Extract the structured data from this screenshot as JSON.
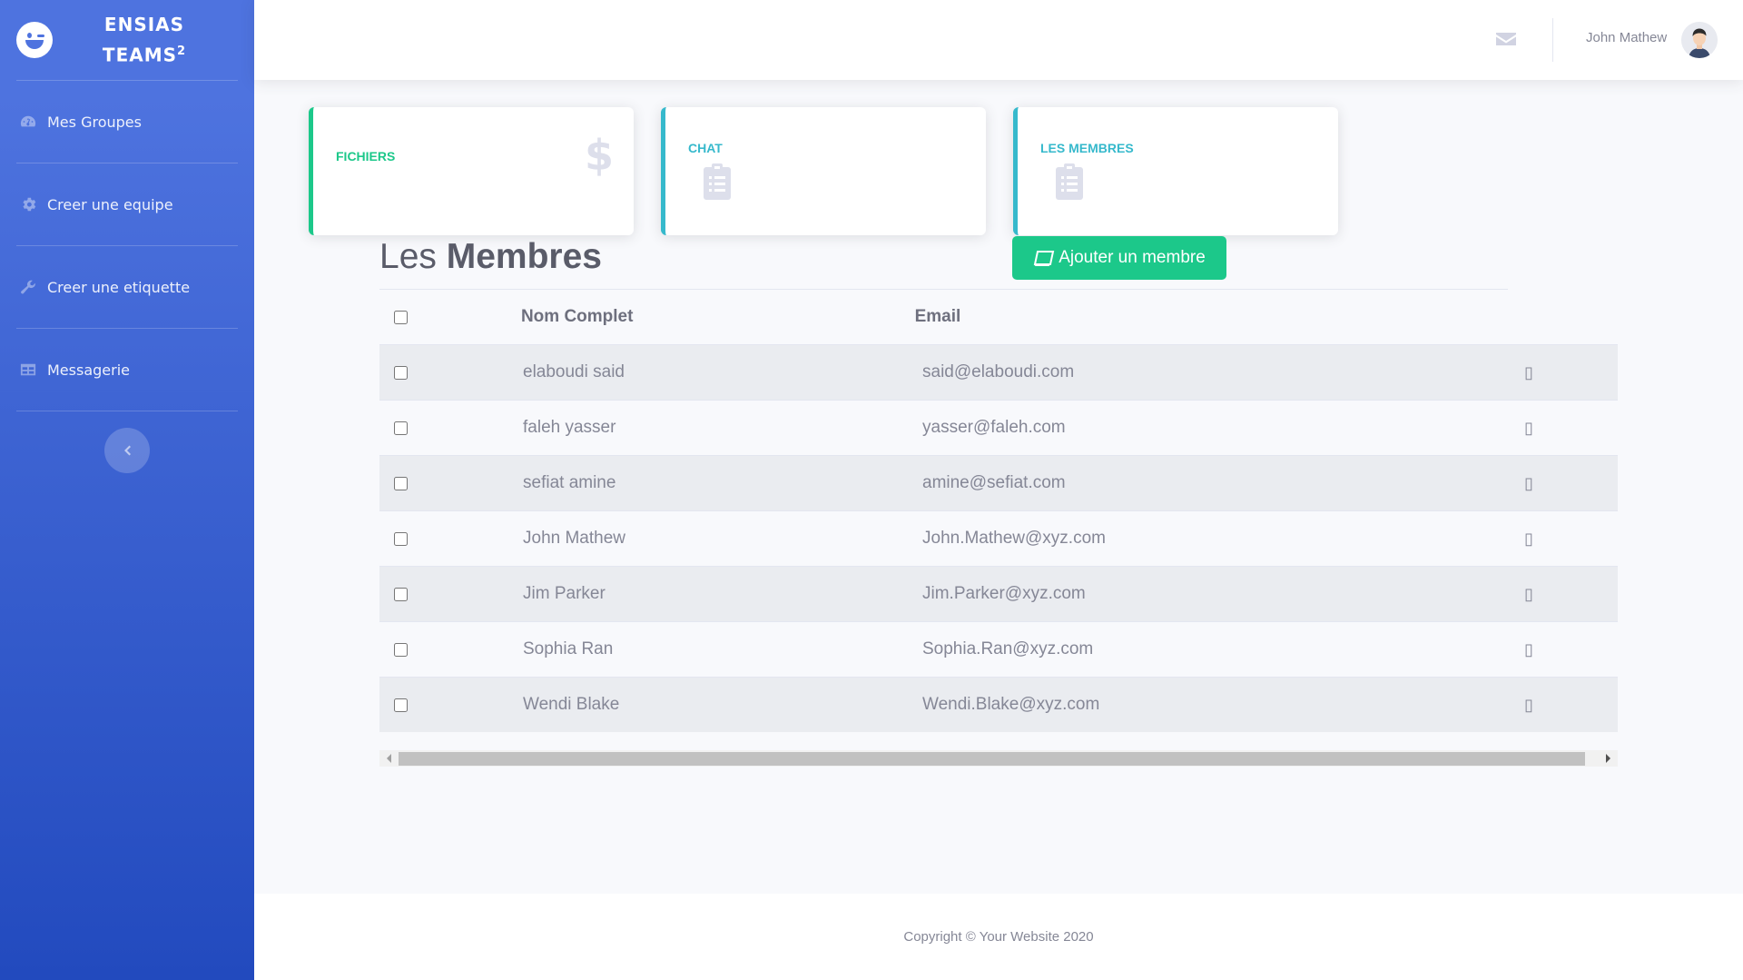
{
  "brand": {
    "line1": "ENSIAS",
    "line2": "TEAMS",
    "sup": "2"
  },
  "sidebar": {
    "items": [
      {
        "label": "Mes Groupes",
        "icon": "tachometer-icon"
      },
      {
        "label": "Creer une equipe",
        "icon": "cog-icon"
      },
      {
        "label": "Creer une etiquette",
        "icon": "wrench-icon"
      },
      {
        "label": "Messagerie",
        "icon": "table-icon"
      }
    ]
  },
  "topbar": {
    "user_name": "John Mathew"
  },
  "cards": [
    {
      "title": "FICHIERS",
      "icon": "dollar-icon"
    },
    {
      "title": "CHAT",
      "icon": "clipboard-list-icon"
    },
    {
      "title": "LES MEMBRES",
      "icon": "clipboard-list-icon"
    }
  ],
  "page": {
    "title_light": "Les",
    "title_bold": "Membres",
    "add_button": "Ajouter un membre"
  },
  "table": {
    "headers": [
      "Nom Complet",
      "Email"
    ],
    "rows": [
      {
        "name": "elaboudi said",
        "email": "said@elaboudi.com",
        "action": "▯"
      },
      {
        "name": "faleh yasser",
        "email": "yasser@faleh.com",
        "action": "▯"
      },
      {
        "name": "sefiat amine",
        "email": "amine@sefiat.com",
        "action": "▯"
      },
      {
        "name": "John Mathew",
        "email": "John.Mathew@xyz.com",
        "action": "▯"
      },
      {
        "name": "Jim Parker",
        "email": "Jim.Parker@xyz.com",
        "action": "▯"
      },
      {
        "name": "Sophia Ran",
        "email": "Sophia.Ran@xyz.com",
        "action": "▯"
      },
      {
        "name": "Wendi Blake",
        "email": "Wendi.Blake@xyz.com",
        "action": "▯"
      }
    ]
  },
  "footer": {
    "copyright": "Copyright © Your Website 2020"
  },
  "colors": {
    "primary": "#4e73df",
    "success": "#1cc88a",
    "info": "#36b9cc"
  }
}
